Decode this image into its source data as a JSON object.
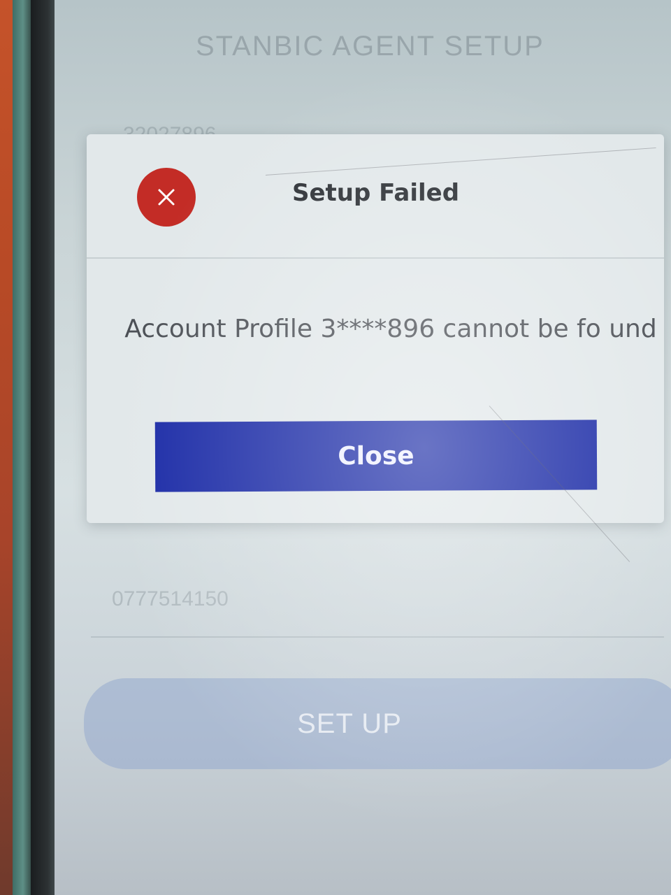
{
  "background_screen": {
    "title": "STANBIC AGENT SETUP",
    "field1_value": "32027896",
    "field2_value": "0777514150",
    "setup_button_label": "SET UP"
  },
  "dialog": {
    "icon": "close-icon",
    "title": "Setup Failed",
    "message": "Account Profile 3****896 cannot be fo und",
    "close_button_label": "Close"
  },
  "colors": {
    "error_red": "#c32c26",
    "close_button_blue": "#1a2aa6",
    "setup_button": "#9aaacf"
  }
}
